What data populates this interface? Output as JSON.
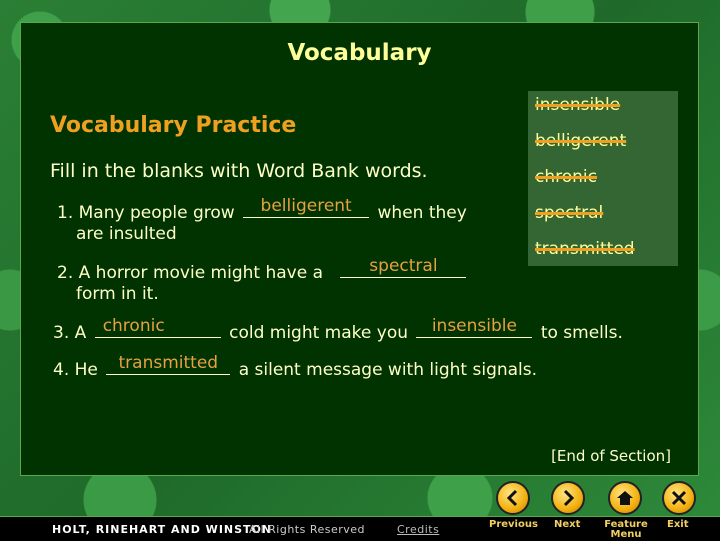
{
  "slide": {
    "title": "Vocabulary",
    "subtitle": "Vocabulary Practice",
    "instructions": "Fill in the blanks with Word Bank words.",
    "end_label": "[End of Section]"
  },
  "word_bank": {
    "words": [
      "insensible",
      "belligerent",
      "chronic",
      "spectral",
      "transmitted"
    ],
    "strike_color": "#f0a020"
  },
  "questions": [
    {
      "num": "1.",
      "before": "Many people grow",
      "answer": "belligerent",
      "after": "when they",
      "line2": "are insulted"
    },
    {
      "num": "2.",
      "before": "A horror movie might have a",
      "answer": "spectral",
      "after": "",
      "line2": "form in it."
    },
    {
      "num": "3.",
      "before": "A",
      "answer": "chronic",
      "middle": "cold might make you",
      "answer2": "insensible",
      "after": "to smells."
    },
    {
      "num": "4.",
      "before": "He",
      "answer": "transmitted",
      "after": "a silent message with light signals."
    }
  ],
  "nav": {
    "previous": "Previous",
    "next": "Next",
    "feature_menu_line1": "Feature",
    "feature_menu_line2": "Menu",
    "exit": "Exit"
  },
  "footer": {
    "publisher": "HOLT, RINEHART AND WINSTON",
    "rights": "All Rights Reserved",
    "credits": "Credits"
  },
  "colors": {
    "panel_bg": "#003300",
    "title": "#ffff99",
    "subtitle": "#f0a020",
    "answer": "#e8a040",
    "word_bank_bg": "#336633"
  }
}
